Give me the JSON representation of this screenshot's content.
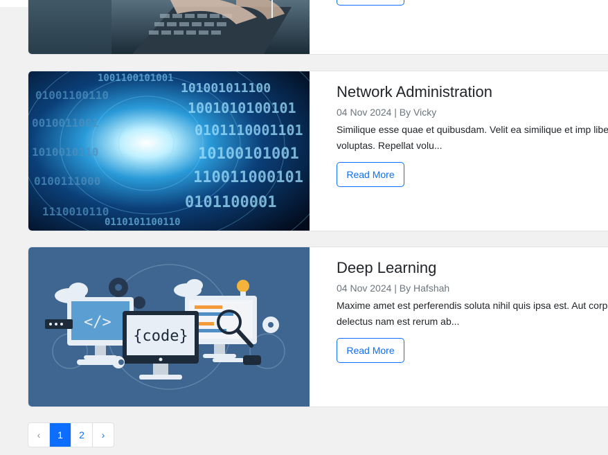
{
  "posts": [
    {
      "title": "",
      "meta": "",
      "excerpt": "",
      "read_more": "",
      "image": "laptop-typing-photo"
    },
    {
      "title": "Network Administration",
      "meta": "04 Nov 2024 | By Vicky",
      "excerpt": "Similique esse quae et quibusdam. Velit ea similique et imp libero id voluptas. Repellat volu...",
      "read_more": "Read More",
      "image": "binary-data-tunnel"
    },
    {
      "title": "Deep Learning",
      "meta": "04 Nov 2024 | By Hafshah",
      "excerpt": "Maxime amet est perferendis soluta nihil quis ipsa est. Aut corporis delectus nam est rerum ab...",
      "read_more": "Read More",
      "image": "code-monitors-illustration",
      "code_label": "{code}",
      "tag_label": "</>"
    }
  ],
  "pagination": {
    "prev": "‹",
    "pages": [
      "1",
      "2"
    ],
    "next": "›",
    "current": "1"
  },
  "colors": {
    "primary": "#0d6efd",
    "page_bg": "#f1f1f1",
    "illustration_bg": "#3f6690"
  }
}
